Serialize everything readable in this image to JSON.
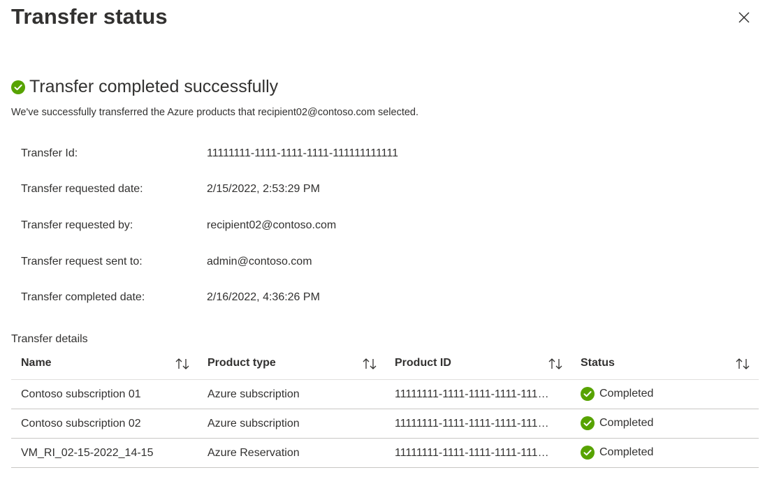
{
  "panel": {
    "title": "Transfer status",
    "close_icon": "close-icon"
  },
  "result": {
    "title": "Transfer completed successfully",
    "description": "We've successfully transferred the Azure products that recipient02@contoso.com selected.",
    "icon": "check-circle-icon",
    "success_color": "#57a300"
  },
  "info": [
    {
      "label": "Transfer Id:",
      "value": "11111111-1111-1111-1111-111111111111"
    },
    {
      "label": "Transfer requested date:",
      "value": "2/15/2022, 2:53:29 PM"
    },
    {
      "label": "Transfer requested by:",
      "value": "recipient02@contoso.com"
    },
    {
      "label": "Transfer request sent to:",
      "value": "admin@contoso.com"
    },
    {
      "label": "Transfer completed date:",
      "value": "2/16/2022, 4:36:26 PM"
    }
  ],
  "details": {
    "label": "Transfer details",
    "columns": [
      "Name",
      "Product type",
      "Product ID",
      "Status"
    ],
    "sort_icon": "sort-icon",
    "rows": [
      {
        "name": "Contoso subscription 01",
        "type": "Azure subscription",
        "product_id": "11111111-1111-1111-1111-111…",
        "status": "Completed"
      },
      {
        "name": "Contoso subscription 02",
        "type": "Azure subscription",
        "product_id": "11111111-1111-1111-1111-111…",
        "status": "Completed"
      },
      {
        "name": "VM_RI_02-15-2022_14-15",
        "type": "Azure Reservation",
        "product_id": "11111111-1111-1111-1111-111…",
        "status": "Completed"
      }
    ]
  }
}
